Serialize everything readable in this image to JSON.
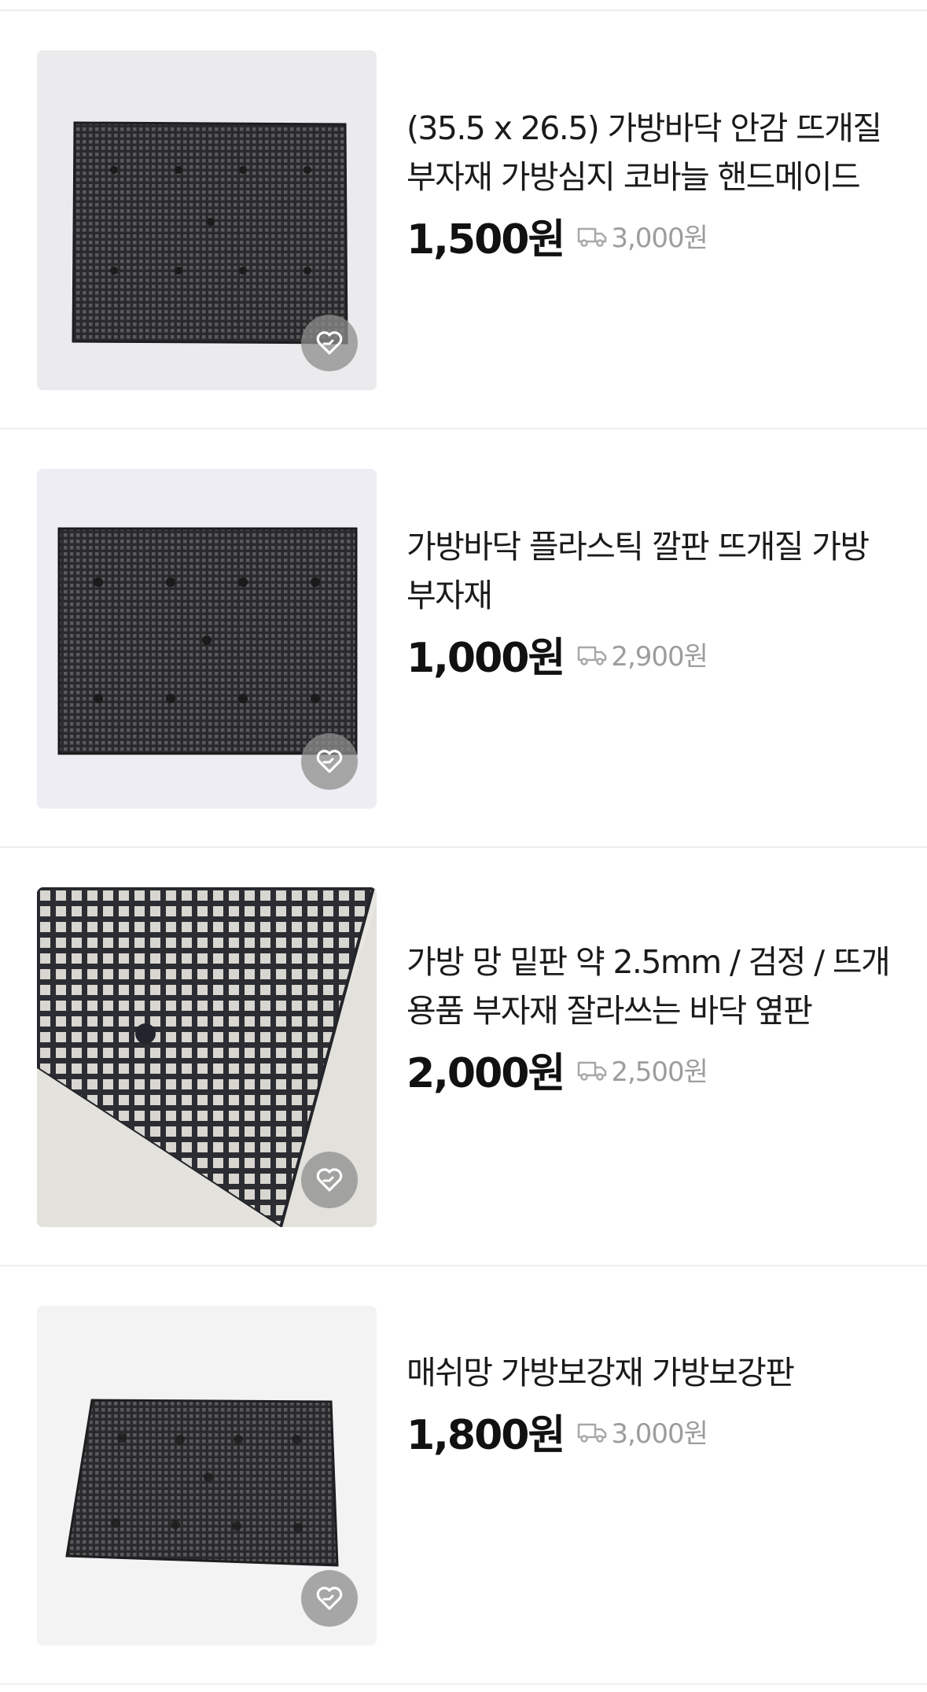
{
  "products": [
    {
      "title_lines": [
        "(35.5 x 26.5) 가방바닥 안감 뜨개질",
        "부자재 가방심지 코바늘 핸드메이드"
      ],
      "price": "1,500원",
      "shipping": "3,000원",
      "image": "black-plastic-mesh-sheet-icon",
      "wish_icon": "heart-icon"
    },
    {
      "title_lines": [
        "가방바닥 플라스틱 깔판 뜨개질 가방",
        "부자재"
      ],
      "price": "1,000원",
      "shipping": "2,900원",
      "image": "black-plastic-mesh-sheet-icon",
      "wish_icon": "heart-icon"
    },
    {
      "title_lines": [
        "가방 망 밑판 약 2.5mm / 검정 / 뜨개",
        "용품 부자재 잘라쓰는 바닥 옆판"
      ],
      "price": "2,000원",
      "shipping": "2,500원",
      "image": "mesh-closeup-icon",
      "wish_icon": "heart-icon"
    },
    {
      "title_lines": [
        "매쉬망 가방보강재 가방보강판"
      ],
      "price": "1,800원",
      "shipping": "3,000원",
      "image": "black-plastic-mesh-sheet-icon",
      "wish_icon": "heart-icon"
    }
  ],
  "colors": {
    "divider": "#efefef",
    "shipping_text": "#9d9d9d",
    "wish_button": "#8c8c8c"
  }
}
